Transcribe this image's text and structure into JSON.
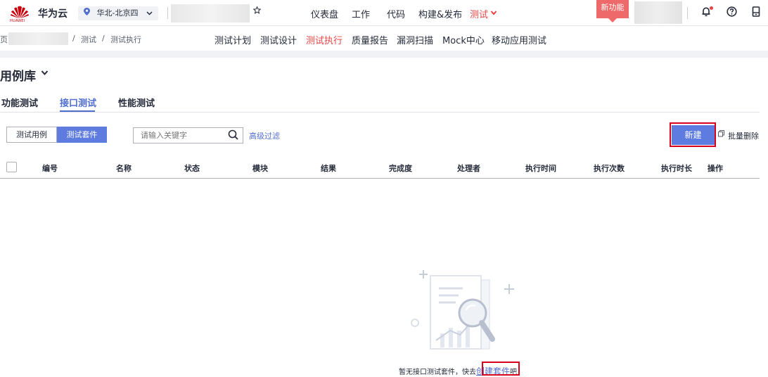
{
  "topbar": {
    "logo_text": "HUAWEI",
    "brand": "华为云",
    "region": "华北-北京四",
    "nav": [
      "仪表盘",
      "工作",
      "代码",
      "构建&发布",
      "测试"
    ],
    "new_feature_badge": "新功能"
  },
  "breadcrumb": {
    "cut_prefix": "页",
    "items": [
      "测试",
      "测试执行"
    ]
  },
  "subnav": [
    "测试计划",
    "测试设计",
    "测试执行",
    "质量报告",
    "漏洞扫描",
    "Mock中心",
    "移动应用测试"
  ],
  "page": {
    "title": "用例库"
  },
  "tabs": [
    "功能测试",
    "接口测试",
    "性能测试"
  ],
  "toolbar": {
    "segment_cases": "测试用例",
    "segment_suites": "测试套件",
    "search_placeholder": "请输入关键字",
    "advanced_filter": "高级过滤",
    "new_button": "新建",
    "batch_delete": "批量删除"
  },
  "table": {
    "columns": [
      "编号",
      "名称",
      "状态",
      "模块",
      "结果",
      "完成度",
      "处理者",
      "执行时间",
      "执行次数",
      "执行时长",
      "操作"
    ]
  },
  "empty_state": {
    "text_prefix": "暂无接口测试套件，快去",
    "link": "创建套件",
    "text_suffix": "吧"
  },
  "colors": {
    "accent": "#5e7ce0",
    "active_nav": "#e84545",
    "highlight_box": "#d9001b"
  }
}
